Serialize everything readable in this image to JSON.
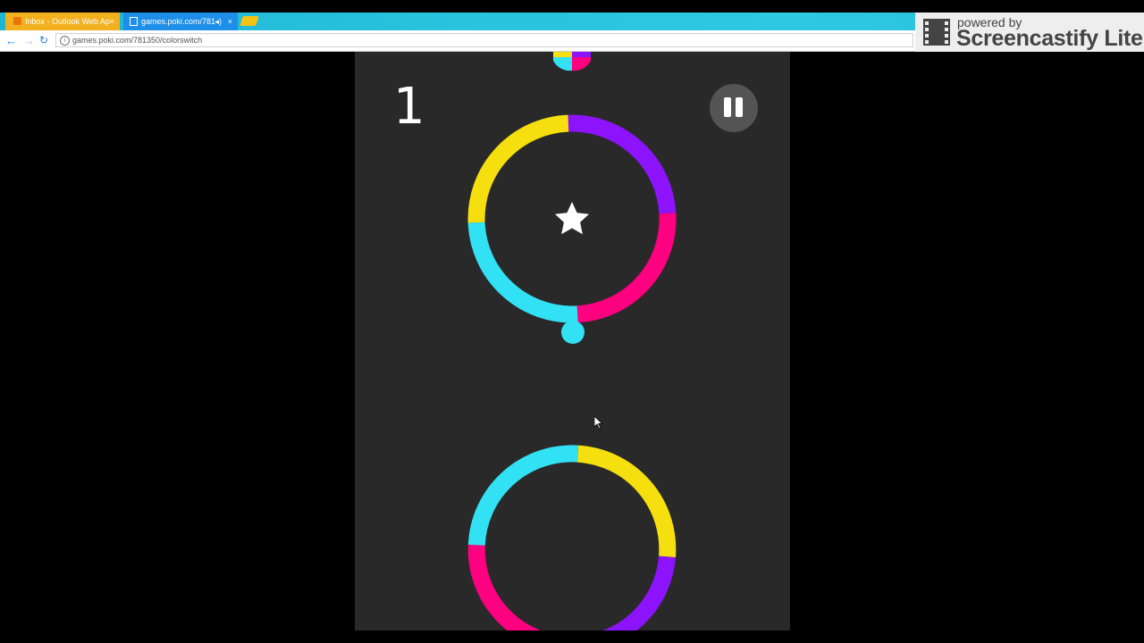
{
  "browser": {
    "tabs": [
      {
        "title": "Inbox - Outlook Web Ap",
        "active": false,
        "close": "×"
      },
      {
        "title": "games.poki.com/781",
        "active": true,
        "close": "×",
        "audio": "◂)"
      }
    ],
    "url": "games.poki.com/781350/colorswitch",
    "nav": {
      "back": "←",
      "forward": "→",
      "reload": "↻"
    },
    "window_controls": {
      "minimize": "–",
      "maximize": "□",
      "close": "×"
    }
  },
  "screencastify": {
    "powered_by": "powered by",
    "name": "Screencastify Lite"
  },
  "game": {
    "score": "1",
    "pause_button": "pause-icon",
    "colors": {
      "yellow": "#f6df0e",
      "purple": "#8c13fb",
      "pink": "#ff0080",
      "cyan": "#32e1f4",
      "background": "#292929"
    },
    "player_ball_color": "cyan",
    "star": "star-icon"
  }
}
